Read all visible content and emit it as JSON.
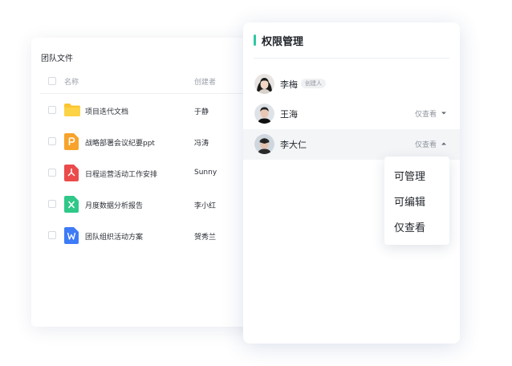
{
  "files_panel": {
    "title": "团队文件",
    "columns": {
      "name": "名称",
      "creator": "创建者"
    },
    "rows": [
      {
        "name": "项目迭代文档",
        "creator": "于静",
        "icon": "folder-icon",
        "color": "#FBC531"
      },
      {
        "name": "战略部署会议纪要ppt",
        "creator": "冯涛",
        "icon": "ppt-file-icon",
        "color": "#F7A32B"
      },
      {
        "name": "日程运营活动工作安排",
        "creator": "Sunny",
        "icon": "pdf-file-icon",
        "color": "#EB4B4B"
      },
      {
        "name": "月度数据分析报告",
        "creator": "李小红",
        "icon": "excel-file-icon",
        "color": "#2FC889"
      },
      {
        "name": "团队组织活动方案",
        "creator": "贺秀兰",
        "icon": "word-file-icon",
        "color": "#3D7BF7"
      }
    ]
  },
  "permission_panel": {
    "title": "权限管理",
    "accent_color": "#2FC8A4",
    "members": [
      {
        "name": "李梅",
        "badge": "创建人",
        "role": ""
      },
      {
        "name": "王海",
        "badge": "",
        "role": "仅查看",
        "caret": "down"
      },
      {
        "name": "李大仁",
        "badge": "",
        "role": "仅查看",
        "caret": "up"
      }
    ],
    "dropdown": {
      "options": [
        "可管理",
        "可编辑",
        "仅查看"
      ]
    }
  }
}
